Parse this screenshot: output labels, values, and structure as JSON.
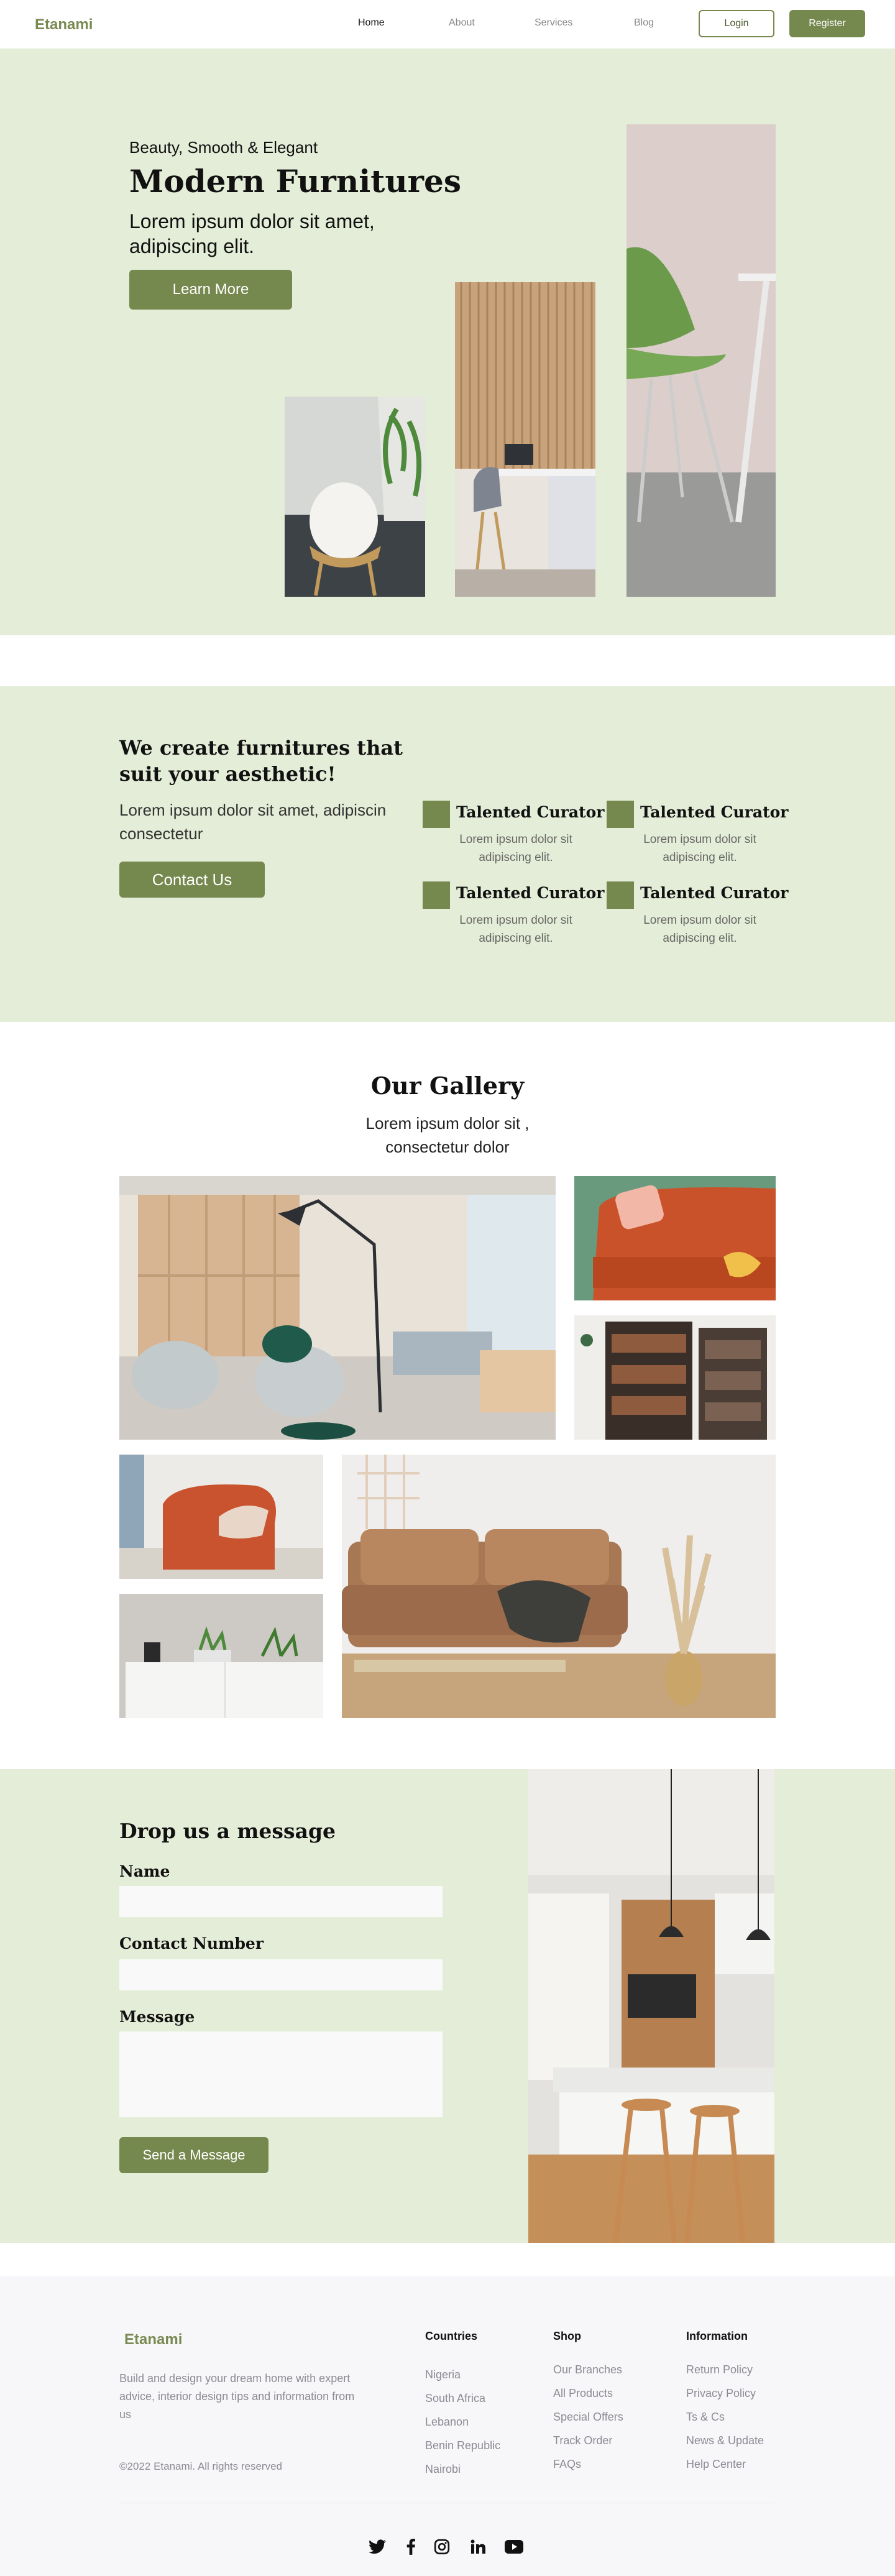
{
  "colors": {
    "accent": "#75884d",
    "hero_bg": "#e4edd7",
    "footer_bg": "#f7f7f9"
  },
  "nav": {
    "logo": "Etanami",
    "links": [
      "Home",
      "About",
      "Services",
      "Blog"
    ],
    "login": "Login",
    "register": "Register"
  },
  "hero": {
    "tagline": "Beauty, Smooth & Elegant",
    "title": "Modern Furnitures",
    "subtitle": "Lorem ipsum dolor sit amet, adipiscing elit.",
    "cta": "Learn More"
  },
  "about": {
    "title": "We create furnitures that suit your aesthetic!",
    "subtitle": "Lorem ipsum dolor sit  amet, adipiscin consectetur",
    "cta": "Contact  Us",
    "features": [
      {
        "title": "Talented Curator",
        "desc": "Lorem ipsum dolor sit adipiscing elit."
      },
      {
        "title": "Talented Curator",
        "desc": "Lorem ipsum dolor sit adipiscing elit."
      },
      {
        "title": "Talented Curator",
        "desc": "Lorem ipsum dolor sit adipiscing elit."
      },
      {
        "title": "Talented Curator",
        "desc": "Lorem ipsum dolor sit adipiscing elit."
      }
    ]
  },
  "gallery": {
    "title": "Our Gallery",
    "subtitle": "Lorem ipsum dolor sit , consectetur  dolor"
  },
  "contact_form": {
    "title": "Drop  us a message",
    "name_label": "Name",
    "number_label": "Contact Number",
    "message_label": "Message",
    "submit": "Send a Message"
  },
  "footer": {
    "logo": "Etanami",
    "description": "Build and design your dream home with expert advice, interior design tips and information from us",
    "copyright": "©2022  Etanami. All rights reserved",
    "countries": {
      "heading": "Countries",
      "items": [
        "Nigeria",
        "South Africa",
        "Lebanon",
        "Benin Republic",
        "Nairobi"
      ]
    },
    "shop": {
      "heading": "Shop",
      "items": [
        "Our Branches",
        "All Products",
        "Special Offers",
        "Track Order",
        "FAQs"
      ]
    },
    "information": {
      "heading": "Information",
      "items": [
        "Return Policy",
        "Privacy Policy",
        "Ts & Cs",
        "News & Update",
        "Help Center"
      ]
    },
    "social_icons": [
      "twitter-icon",
      "facebook-icon",
      "instagram-icon",
      "linkedin-icon",
      "youtube-icon"
    ]
  }
}
